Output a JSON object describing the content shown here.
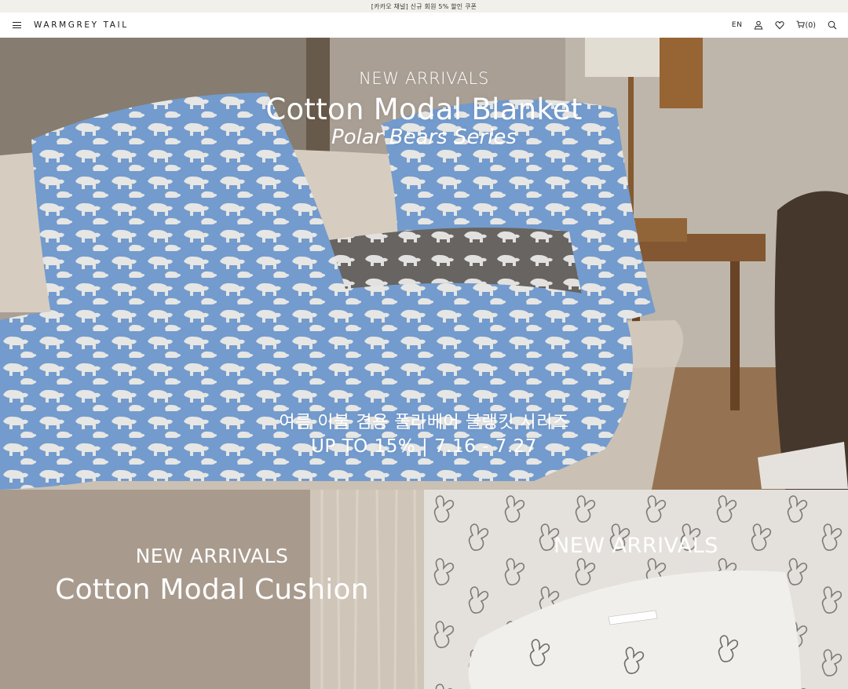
{
  "announcement": {
    "text": "[카카오 채널] 신규 회원 5% 할인 쿠폰"
  },
  "header": {
    "logo": "WARMGREY TAIL",
    "lang": "EN",
    "cart_label": "(0)",
    "icons": [
      "menu-icon",
      "user-icon",
      "heart-icon",
      "cart-icon",
      "search-icon"
    ]
  },
  "hero": {
    "eyebrow": "NEW ARRIVALS",
    "title": "Cotton Modal Blanket",
    "subtitle": "Polar Bears Series",
    "kr_caption": "여름 이불 겸용 폴라베어 블랭킷 시리즈",
    "promo": "UP TO 15%  |  7.16 - 7.27"
  },
  "panel_left": {
    "eyebrow": "NEW ARRIVALS",
    "title": "Cotton Modal Cushion"
  },
  "panel_right": {
    "eyebrow": "NEW ARRIVALS"
  },
  "colors": {
    "announce_bg": "#f2f0ea",
    "blanket_blue": "#7aa4d8",
    "bear_white": "#f4f4f2",
    "cushion_grey": "#6f6c69"
  }
}
